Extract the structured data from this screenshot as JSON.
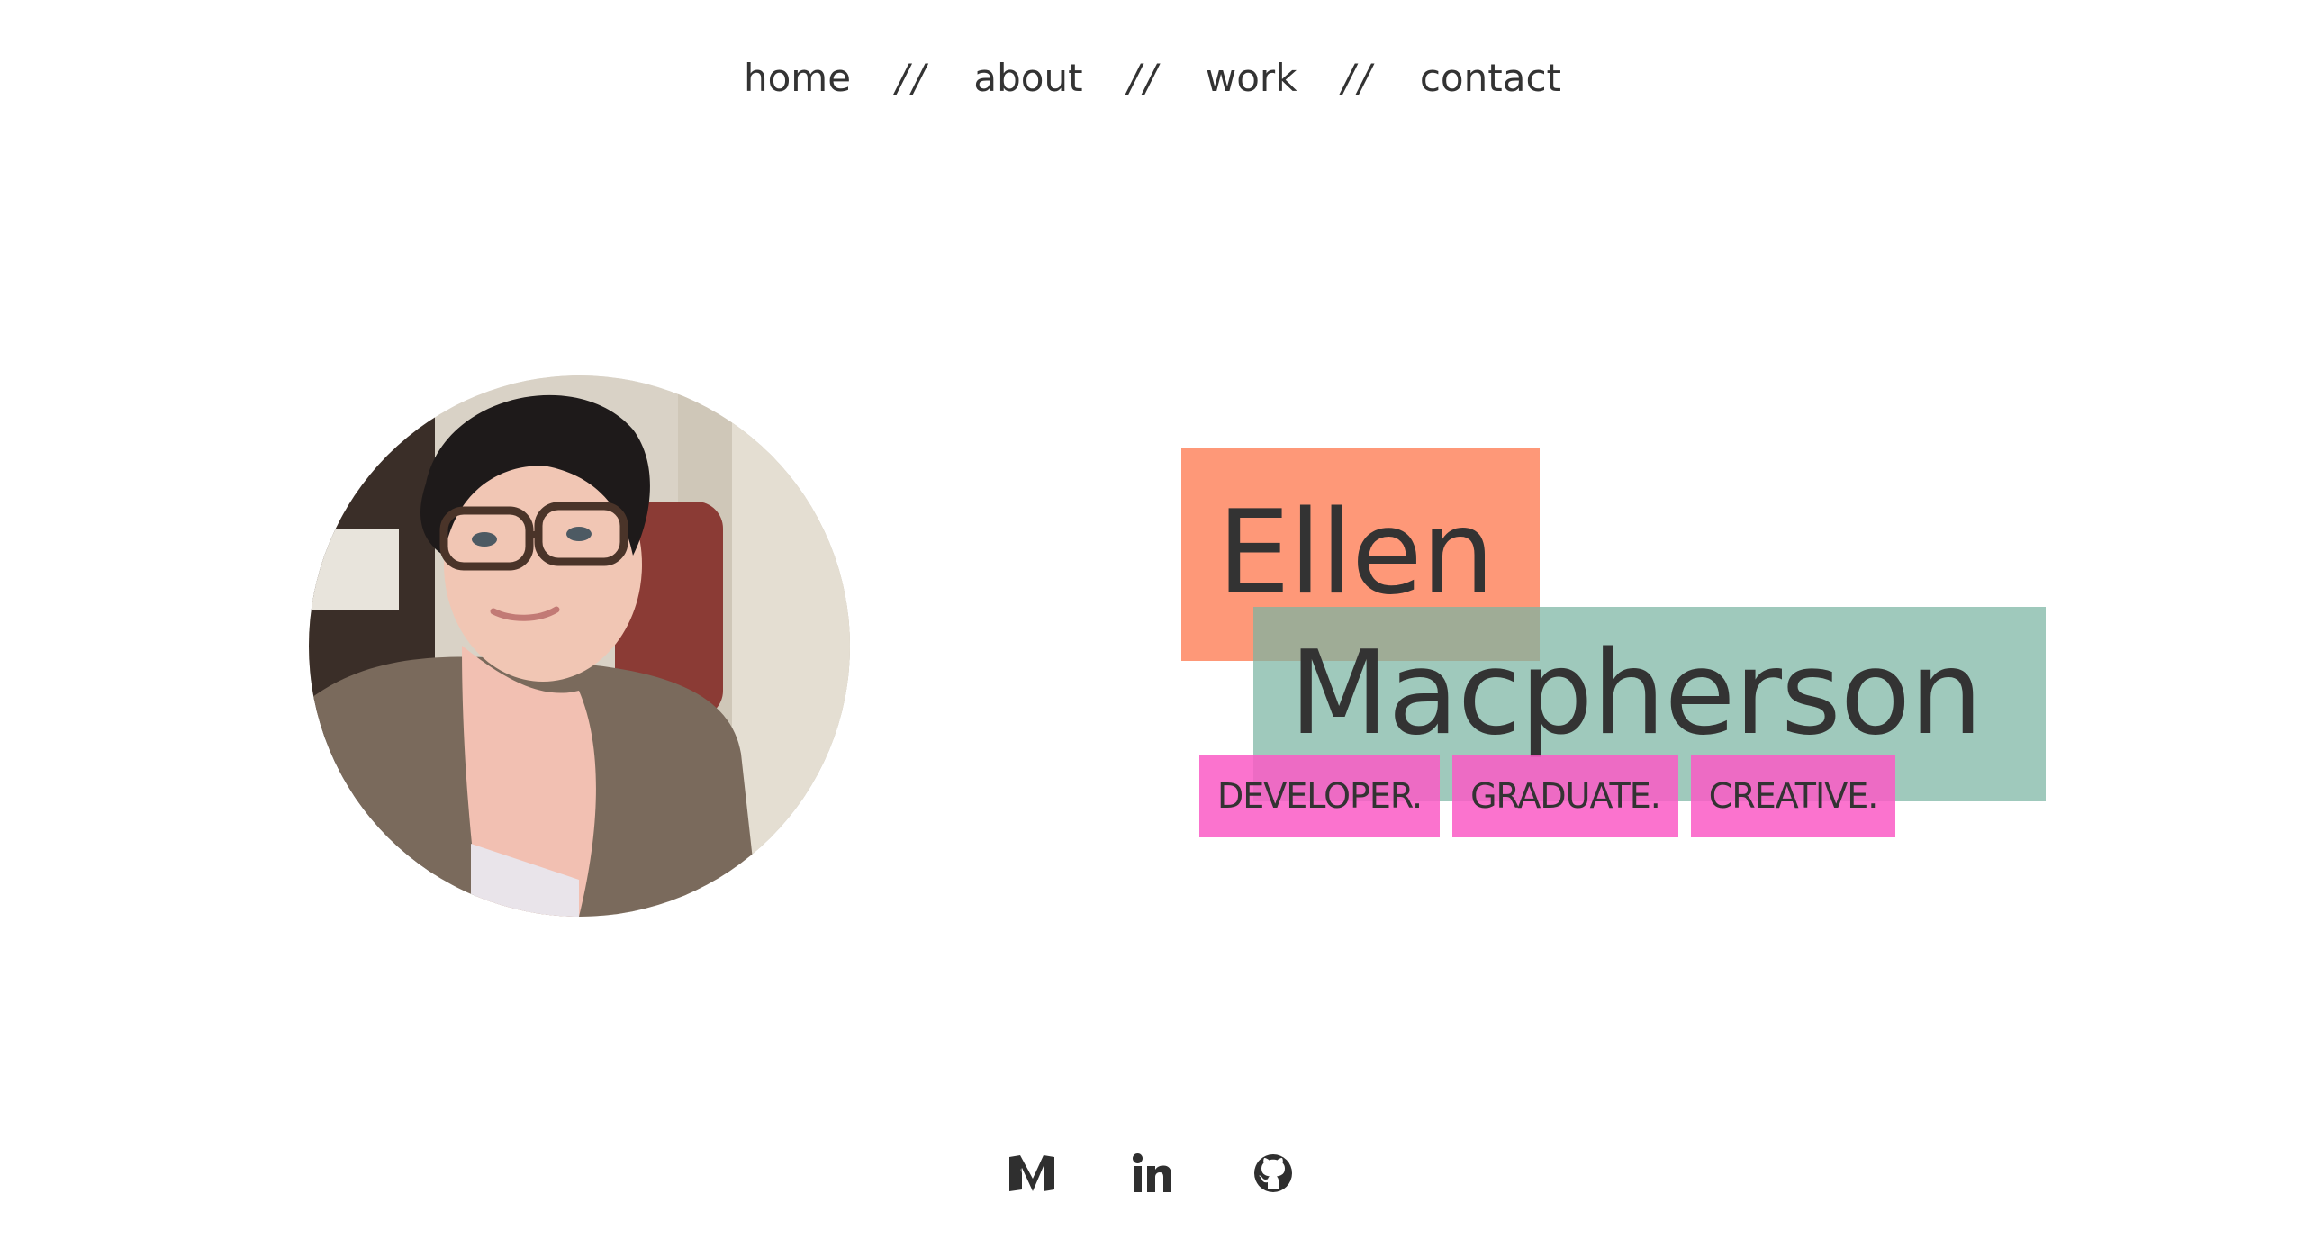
{
  "nav": {
    "items": [
      {
        "label": "home"
      },
      {
        "label": "about"
      },
      {
        "label": "work"
      },
      {
        "label": "contact"
      }
    ],
    "separator": "//"
  },
  "hero": {
    "first_name": "Ellen",
    "last_name": "Macpherson",
    "tags": [
      "DEVELOPER.",
      "GRADUATE.",
      "CREATIVE."
    ]
  },
  "social": {
    "icons": [
      "medium-icon",
      "linkedin-icon",
      "github-icon"
    ]
  },
  "colors": {
    "text": "#333333",
    "orange": "#fe9878",
    "green": "#9fc5b7",
    "pink": "#fb77cf",
    "background": "#ffffff"
  }
}
